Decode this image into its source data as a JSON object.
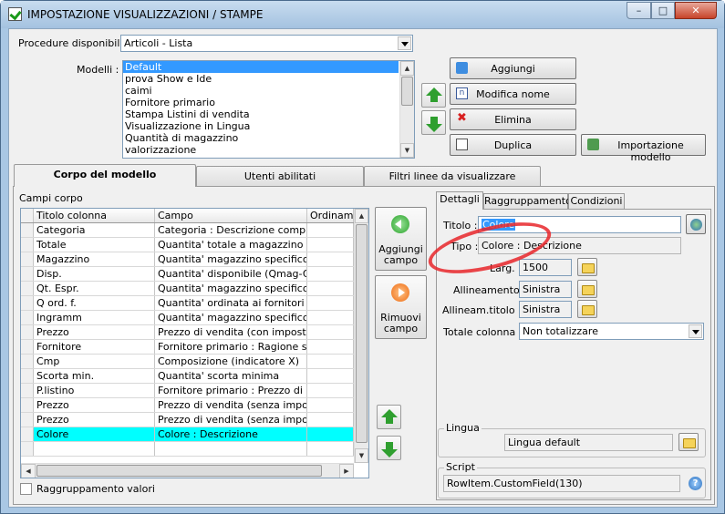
{
  "window": {
    "title": "IMPOSTAZIONE VISUALIZZAZIONI / STAMPE",
    "min": "–",
    "max": "□",
    "close": "✕"
  },
  "procedure": {
    "label": "Procedure disponibili :",
    "value": "Articoli - Lista"
  },
  "modelli": {
    "label": "Modelli :",
    "items": [
      "Default",
      "prova Show e Ide",
      "caimi",
      "Fornitore primario",
      "Stampa Listini di vendita",
      "Visualizzazione in Lingua",
      "Quantità di magazzino",
      "valorizzazione"
    ],
    "selected_index": 0
  },
  "model_buttons": {
    "add": "Aggiungi",
    "rename": "Modifica nome",
    "delete": "Elimina",
    "duplicate": "Duplica",
    "import": "Importazione modello"
  },
  "tabs": [
    "Corpo del modello",
    "Utenti abilitati",
    "Filtri linee da visualizzare"
  ],
  "campi": {
    "group_label": "Campi corpo",
    "columns": [
      "Titolo colonna",
      "Campo",
      "Ordinamento"
    ],
    "rows": [
      [
        "Categoria",
        "Categoria : Descrizione complet…"
      ],
      [
        "Totale",
        "Quantita' totale a magazzino"
      ],
      [
        "Magazzino",
        "Quantita' magazzino specifico"
      ],
      [
        "Disp.",
        "Quantita' disponibile (Qmag-Qord)"
      ],
      [
        "Qt. Espr.",
        "Quantita' magazzino specifico"
      ],
      [
        "Q ord. f.",
        "Quantita' ordinata ai fornitori"
      ],
      [
        "Ingramm",
        "Quantita' magazzino specifico"
      ],
      [
        "Prezzo",
        "Prezzo di vendita (con imposte)"
      ],
      [
        "Fornitore",
        "Fornitore primario : Ragione soci…"
      ],
      [
        "Cmp",
        "Composizione (indicatore X)"
      ],
      [
        "Scorta min.",
        "Quantita' scorta minima"
      ],
      [
        "P.listino",
        "Fornitore primario : Prezzo di listino"
      ],
      [
        "Prezzo",
        "Prezzo di vendita (senza imposte)"
      ],
      [
        "Prezzo",
        "Prezzo di vendita (senza imposte)"
      ],
      [
        "Colore",
        "Colore : Descrizione"
      ]
    ],
    "selected_index": 14,
    "add_field": "Aggiungi campo",
    "remove_field": "Rimuovi campo",
    "raggruppamento": "Raggruppamento valori"
  },
  "detail_tabs": [
    "Dettagli",
    "Raggruppamento",
    "Condizioni"
  ],
  "dettagli": {
    "titolo_label": "Titolo :",
    "titolo_value": "Colore",
    "tipo_label": "Tipo :",
    "tipo_value": "Colore : Descrizione",
    "larg_label": "Larg. :",
    "larg_value": "1500",
    "allineamento_label": "Allineamento :",
    "allineamento_value": "Sinistra",
    "allineam_titolo_label": "Allineam.titolo :",
    "allineam_titolo_value": "Sinistra",
    "totale_label": "Totale colonna :",
    "totale_value": "Non totalizzare",
    "lingua_legend": "Lingua",
    "lingua_value": "Lingua default",
    "script_legend": "Script",
    "script_value": "RowItem.CustomField(130)"
  },
  "colors": {
    "selection": "#3399ff",
    "grid_selection": "#00ffff",
    "annotation": "#e8262a"
  }
}
